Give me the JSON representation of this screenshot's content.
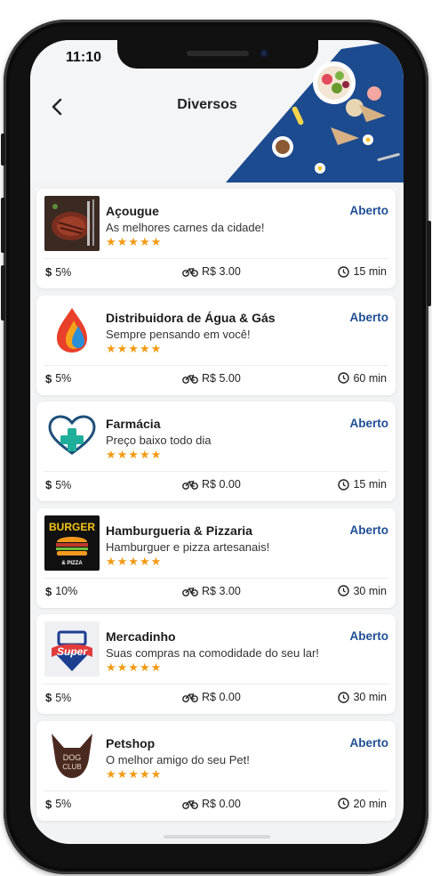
{
  "status_bar": {
    "time": "11:10"
  },
  "header": {
    "title": "Diversos",
    "back_icon": "chevron-left-icon"
  },
  "colors": {
    "accent": "#1f4e94",
    "star": "#f29a13",
    "hero_blue": "#1d4b8f"
  },
  "stores": [
    {
      "name": "Açougue",
      "description": "As melhores carnes da cidade!",
      "status": "Aberto",
      "rating": "★★★★★",
      "fee_percent": "5%",
      "delivery_fee": "R$ 3.00",
      "delivery_time": "15 min",
      "thumb": "meat"
    },
    {
      "name": "Distribuidora de Água & Gás",
      "description": "Sempre pensando em você!",
      "status": "Aberto",
      "rating": "★★★★★",
      "fee_percent": "5%",
      "delivery_fee": "R$ 5.00",
      "delivery_time": "60 min",
      "thumb": "fire-water"
    },
    {
      "name": "Farmácia",
      "description": "Preço baixo todo dia",
      "status": "Aberto",
      "rating": "★★★★★",
      "fee_percent": "5%",
      "delivery_fee": "R$ 0.00",
      "delivery_time": "15 min",
      "thumb": "pharmacy"
    },
    {
      "name": "Hamburgueria & Pizzaria",
      "description": "Hamburguer e pizza artesanais!",
      "status": "Aberto",
      "rating": "★★★★★",
      "fee_percent": "10%",
      "delivery_fee": "R$ 3.00",
      "delivery_time": "30 min",
      "thumb": "burger"
    },
    {
      "name": "Mercadinho",
      "description": "Suas compras na comodidade do seu lar!",
      "status": "Aberto",
      "rating": "★★★★★",
      "fee_percent": "5%",
      "delivery_fee": "R$ 0.00",
      "delivery_time": "30 min",
      "thumb": "super"
    },
    {
      "name": "Petshop",
      "description": "O melhor amigo do seu Pet!",
      "status": "Aberto",
      "rating": "★★★★★",
      "fee_percent": "5%",
      "delivery_fee": "R$ 0.00",
      "delivery_time": "20 min",
      "thumb": "dog"
    }
  ],
  "logo_text": {
    "burger": "BURGER",
    "burger_sub": "& PIZZA",
    "super": "Super",
    "dog_line1": "DOG",
    "dog_line2": "CLUB"
  }
}
